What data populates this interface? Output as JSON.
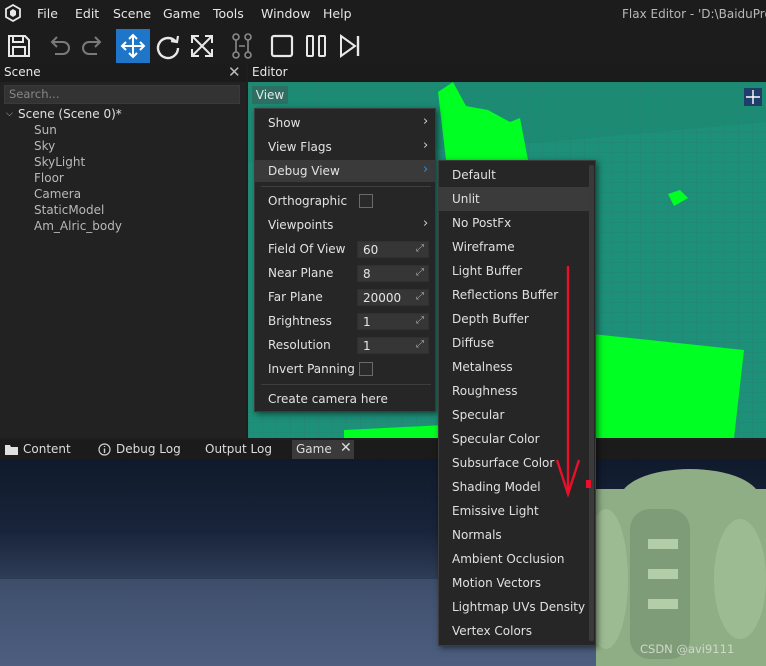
{
  "menubar": {
    "items": [
      "File",
      "Edit",
      "Scene",
      "Game",
      "Tools",
      "Window",
      "Help"
    ],
    "window_title": "Flax Editor - 'D:\\BaiduProje"
  },
  "toolbar": {
    "buttons": [
      "save-icon",
      "undo-icon",
      "redo-icon",
      "move-icon",
      "rotate-icon",
      "scale-icon",
      "snap-icon",
      "stop-icon",
      "pause-icon",
      "step-icon"
    ],
    "accent": "#1f76c8"
  },
  "scene_panel": {
    "title": "Scene",
    "close_label": "✕",
    "search_placeholder": "Search...",
    "root": "Scene (Scene 0)*",
    "children": [
      "Sun",
      "Sky",
      "SkyLight",
      "Floor",
      "Camera",
      "StaticModel",
      "Am_Alric_body"
    ]
  },
  "editor": {
    "title": "Editor",
    "view_button": "View"
  },
  "view_menu": {
    "show": "Show",
    "view_flags": "View Flags",
    "debug_view": "Debug View",
    "orthographic": "Orthographic",
    "viewpoints": "Viewpoints",
    "field_of_view": {
      "label": "Field Of View",
      "value": "60"
    },
    "near_plane": {
      "label": "Near Plane",
      "value": "8"
    },
    "far_plane": {
      "label": "Far Plane",
      "value": "20000"
    },
    "brightness": {
      "label": "Brightness",
      "value": "1"
    },
    "resolution": {
      "label": "Resolution",
      "value": "1"
    },
    "invert_panning": "Invert Panning",
    "create_camera": "Create camera here"
  },
  "debug_menu": {
    "items": [
      "Default",
      "Unlit",
      "No PostFx",
      "Wireframe",
      "Light Buffer",
      "Reflections Buffer",
      "Depth Buffer",
      "Diffuse",
      "Metalness",
      "Roughness",
      "Specular",
      "Specular Color",
      "Subsurface Color",
      "Shading Model",
      "Emissive Light",
      "Normals",
      "Ambient Occlusion",
      "Motion Vectors",
      "Lightmap UVs Density",
      "Vertex Colors"
    ],
    "highlighted": "Unlit"
  },
  "bottom_tabs": {
    "content": "Content",
    "debug_log": "Debug Log",
    "output_log": "Output Log",
    "game": "Game",
    "game_close": "✕"
  },
  "watermark": "CSDN @avi9111",
  "colors": {
    "viewport_green": "#1e8f76",
    "bright_green": "#00ff22",
    "annotation_red": "#e8102a"
  }
}
